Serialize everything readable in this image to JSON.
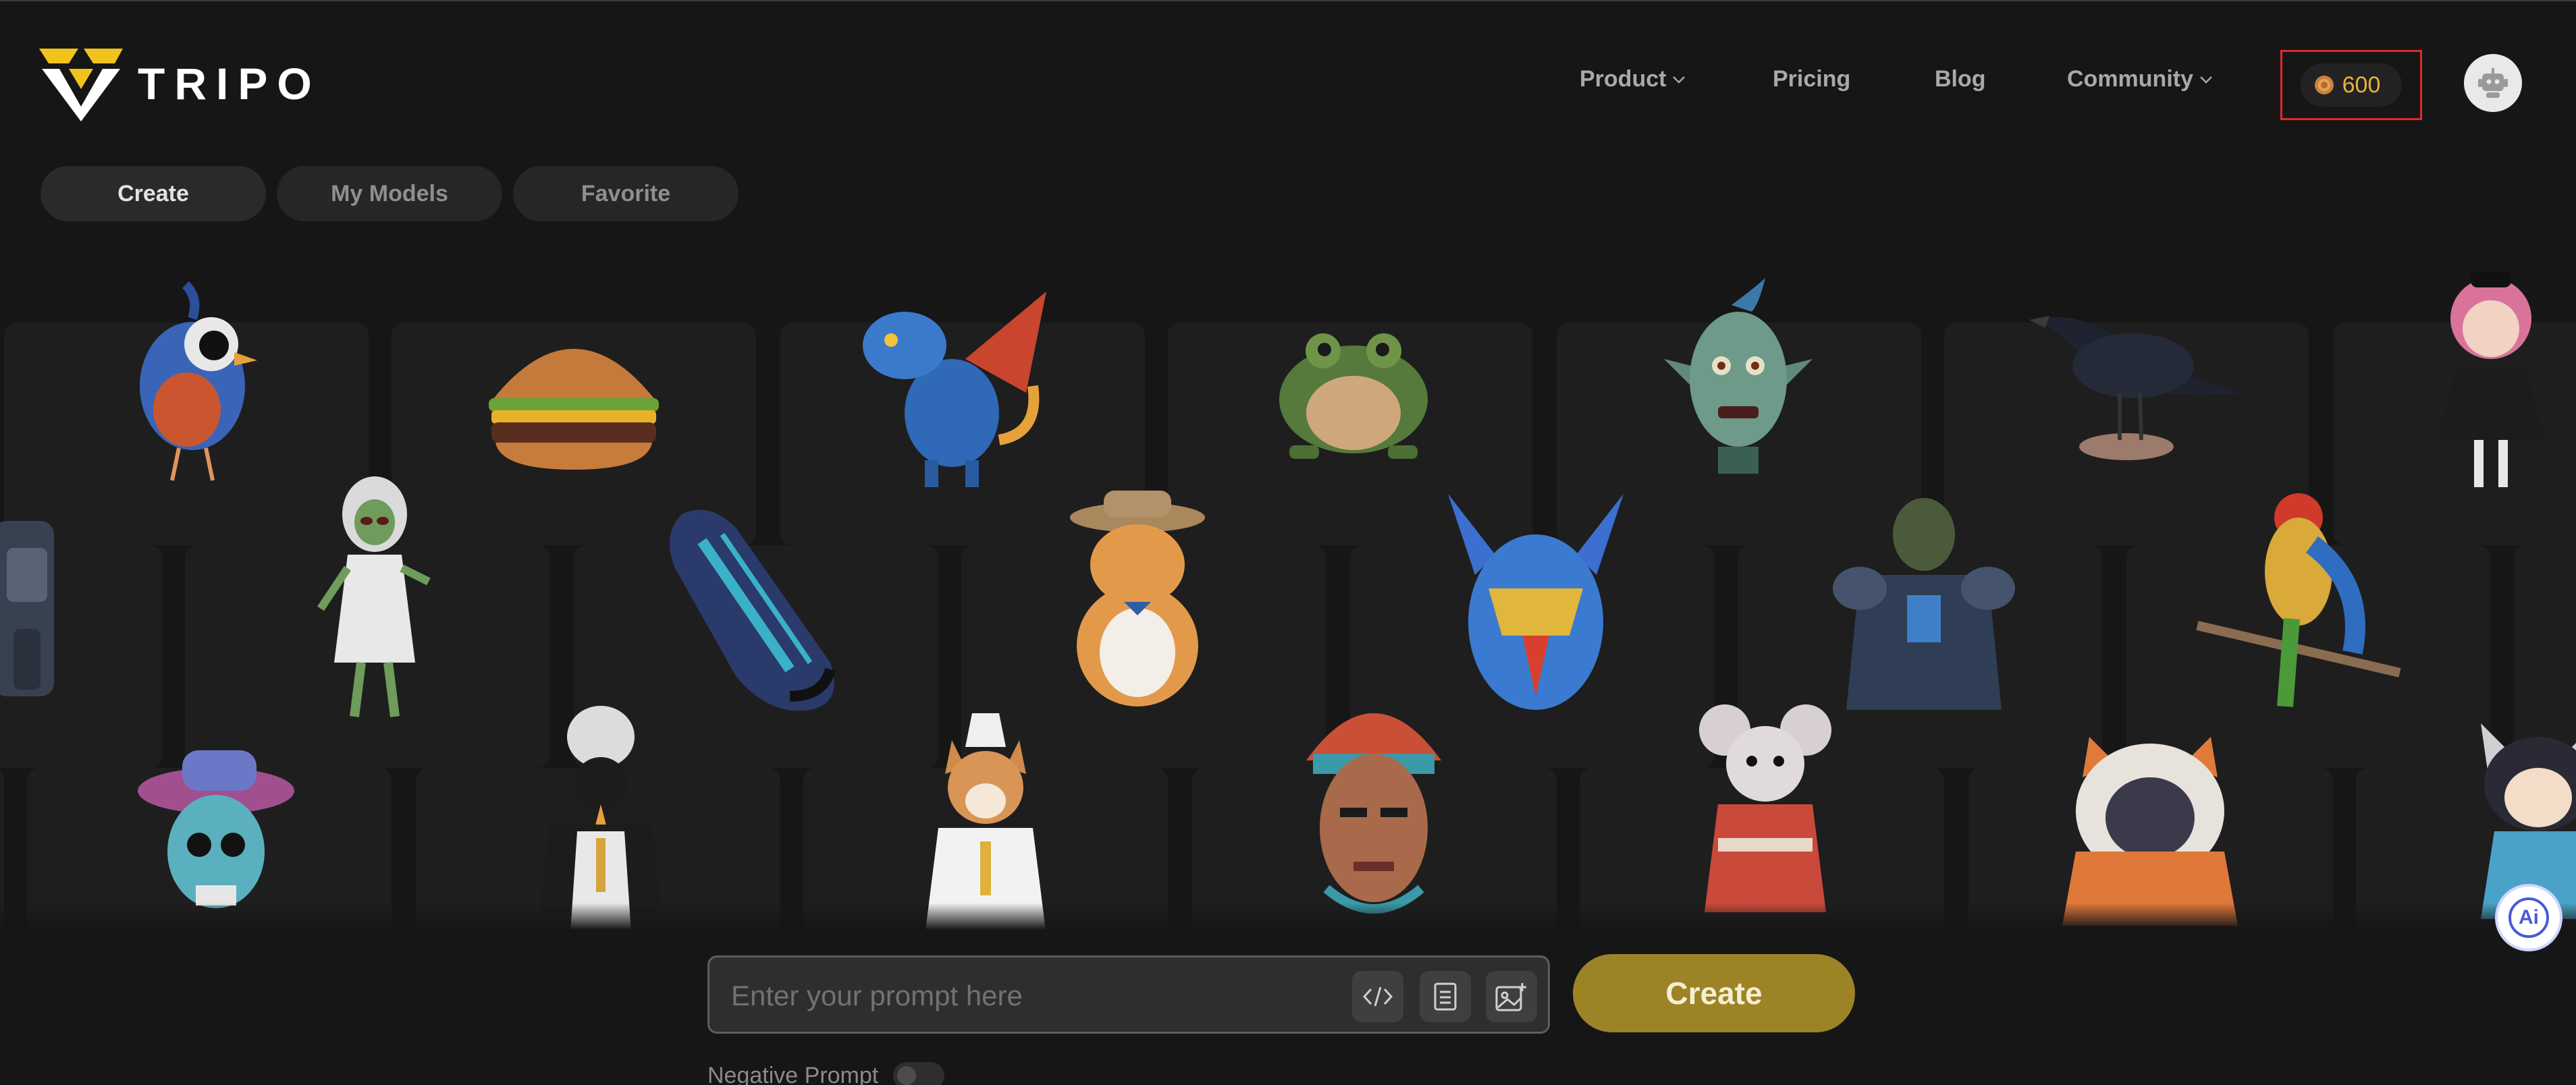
{
  "brand": {
    "name": "TRIPO"
  },
  "nav": {
    "items": [
      {
        "label": "Product",
        "has_dropdown": true
      },
      {
        "label": "Pricing",
        "has_dropdown": false
      },
      {
        "label": "Blog",
        "has_dropdown": false
      },
      {
        "label": "Community",
        "has_dropdown": true
      }
    ],
    "credits": "600",
    "avatar_icon": "robot-avatar-icon"
  },
  "tabs": [
    {
      "label": "Create",
      "active": true
    },
    {
      "label": "My Models",
      "active": false
    },
    {
      "label": "Favorite",
      "active": false
    }
  ],
  "gallery": {
    "rows": [
      [
        "bird",
        "burger",
        "dragon",
        "toad",
        "goblin-head",
        "crow",
        "doll-girl"
      ],
      [
        "armored-knight",
        "alien",
        "sneaker",
        "cat-in-hat",
        "robot-helmet",
        "orc-warrior",
        "parrot"
      ],
      [
        "skull-cowboy",
        "penguin-priest",
        "shiba-pope",
        "tribal-mask",
        "mouse-kimono",
        "hooded-fox",
        "raccoon-girl"
      ]
    ]
  },
  "prompt": {
    "placeholder": "Enter your prompt here",
    "value": "",
    "tools": [
      "code-icon",
      "document-icon",
      "image-upload-icon"
    ],
    "create_label": "Create",
    "negative_prompt_label": "Negative Prompt",
    "negative_prompt_enabled": false
  },
  "assistant": {
    "label": "Ai"
  },
  "colors": {
    "background": "#161616",
    "tile": "#1e1e1e",
    "accent": "#9c8326",
    "credits": "#e6b43c",
    "highlight": "#e0282a"
  }
}
